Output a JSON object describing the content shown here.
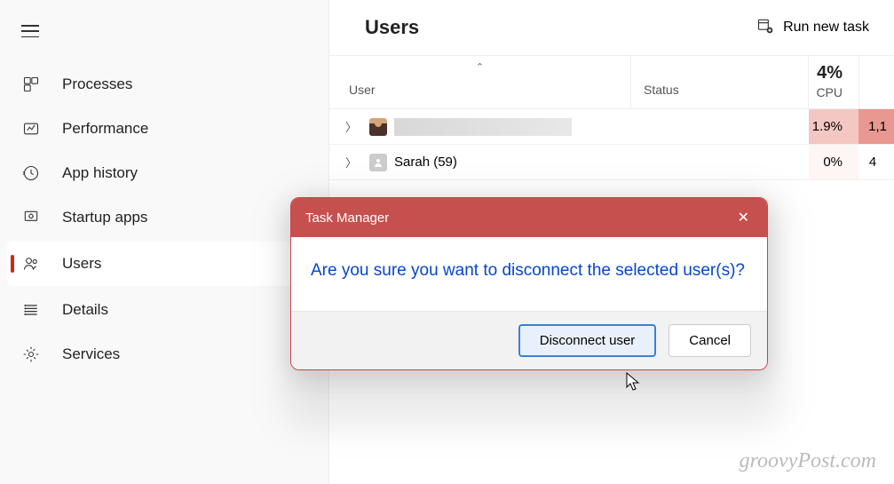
{
  "sidebar": {
    "items": [
      {
        "label": "Processes",
        "icon": "processes"
      },
      {
        "label": "Performance",
        "icon": "performance"
      },
      {
        "label": "App history",
        "icon": "history"
      },
      {
        "label": "Startup apps",
        "icon": "startup"
      },
      {
        "label": "Users",
        "icon": "users",
        "active": true
      },
      {
        "label": "Details",
        "icon": "details"
      },
      {
        "label": "Services",
        "icon": "services"
      }
    ]
  },
  "header": {
    "title": "Users",
    "run_task_label": "Run new task"
  },
  "table": {
    "columns": {
      "user": "User",
      "status": "Status",
      "cpu": "CPU"
    },
    "cpu_total": "4%",
    "rows": [
      {
        "name": "",
        "cpu": "1.9%",
        "extra": "1,1",
        "selected": true
      },
      {
        "name": "Sarah (59)",
        "cpu": "0%",
        "extra": "4"
      }
    ]
  },
  "dialog": {
    "title": "Task Manager",
    "message": "Are you sure you want to disconnect the selected user(s)?",
    "primary_button": "Disconnect user",
    "cancel_button": "Cancel"
  },
  "watermark": "groovyPost.com"
}
